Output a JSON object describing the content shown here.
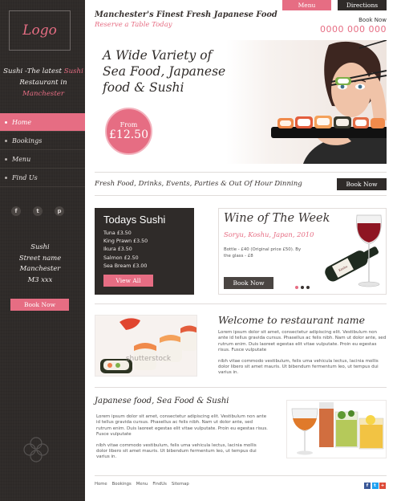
{
  "sidebar": {
    "logo": "Logo",
    "tagline_prefix": "Sushi -The latest",
    "tagline_highlight": "Sushi",
    "tagline_mid": "Restaurant in",
    "tagline_city": "Manchester",
    "nav": [
      {
        "label": "Home",
        "active": true
      },
      {
        "label": "Bookings",
        "active": false
      },
      {
        "label": "Menu",
        "active": false
      },
      {
        "label": "Find Us",
        "active": false
      }
    ],
    "social": [
      "facebook-icon",
      "twitter-icon",
      "pinterest-icon"
    ],
    "address": [
      "Sushi",
      "Street name",
      "Manchester",
      "M3 xxx"
    ],
    "book_button": "Book Now"
  },
  "header": {
    "title": "Manchester's Finest Fresh Japanese Food",
    "reserve": "Reserve a Table Today",
    "menu_button": "Menu",
    "directions_button": "Directions",
    "book_label": "Book Now",
    "phone": "0000 000 000"
  },
  "hero": {
    "headline_1": "A Wide Variety of",
    "headline_2": "Sea Food, Japanese",
    "headline_3": "food & Sushi",
    "from": "From",
    "price": "£12.50"
  },
  "strap": {
    "text": "Fresh Food, Drinks, Events, Parties  & Out Of Hour Dinning",
    "button": "Book Now"
  },
  "today": {
    "title": "Todays Sushi",
    "items": [
      "Tuna £3.50",
      "King Prawn £3.50",
      "Ikura £3.50",
      "Salmon £2.50",
      "Sea Bream £3.00"
    ],
    "button": "View All"
  },
  "wine": {
    "title": "Wine of The Week",
    "subtitle": "Soryu, Koshu, Japan, 2010",
    "desc": "Bottle - £40 (Original price £50). By the glass - £8",
    "button": "Book Now",
    "bottle_label": "Koshu"
  },
  "welcome": {
    "title": "Welcome to restaurant name",
    "watermark": "shutterstock",
    "p1": "Lorem ipsum dolor sit amet, consectetur adipiscing elit. Vestibulum non ante id tellus gravida cursus. Phasellus ac felis nibh. Nam ut dolor ante, sed rutrum enim. Duis laoreet egestas elit vitae vulputate. Proin eu egestas risus. Fusce vulputate",
    "p2": "nibh vitae commodo vestibulum, felis uma vehicula lectus, lacinia mollis dolor libero sit amet mauris. Ut bibendum fermentum leo, ut tempus dui varius in."
  },
  "japanese": {
    "title": "Japanese food, Sea Food & Sushi",
    "p1": "Lorem ipsum dolor sit amet, consectetur adipiscing elit. Vestibulum non ante id tellus gravida cursus. Phasellus ac felis nibh. Nam ut dolor ante, sed rutrum enim. Duis laoreet egestas elit vitae vulputate. Proin eu egestas risus. Fusce vulputate",
    "p2": "nibh vitae commodo vestibulum, felis uma vehicula lectus, lacinia mollis dolor libero sit amet mauris. Ut bibendum fermentum leo, ut tempus dui varius in."
  },
  "footer": {
    "links": [
      "Home",
      "Bookings",
      "Menu",
      "FindUs",
      "Sitemap"
    ],
    "icons": [
      "facebook-icon",
      "twitter-icon",
      "google-plus-icon"
    ]
  },
  "colors": {
    "accent": "#e66d83",
    "dark": "#2f2b29"
  }
}
